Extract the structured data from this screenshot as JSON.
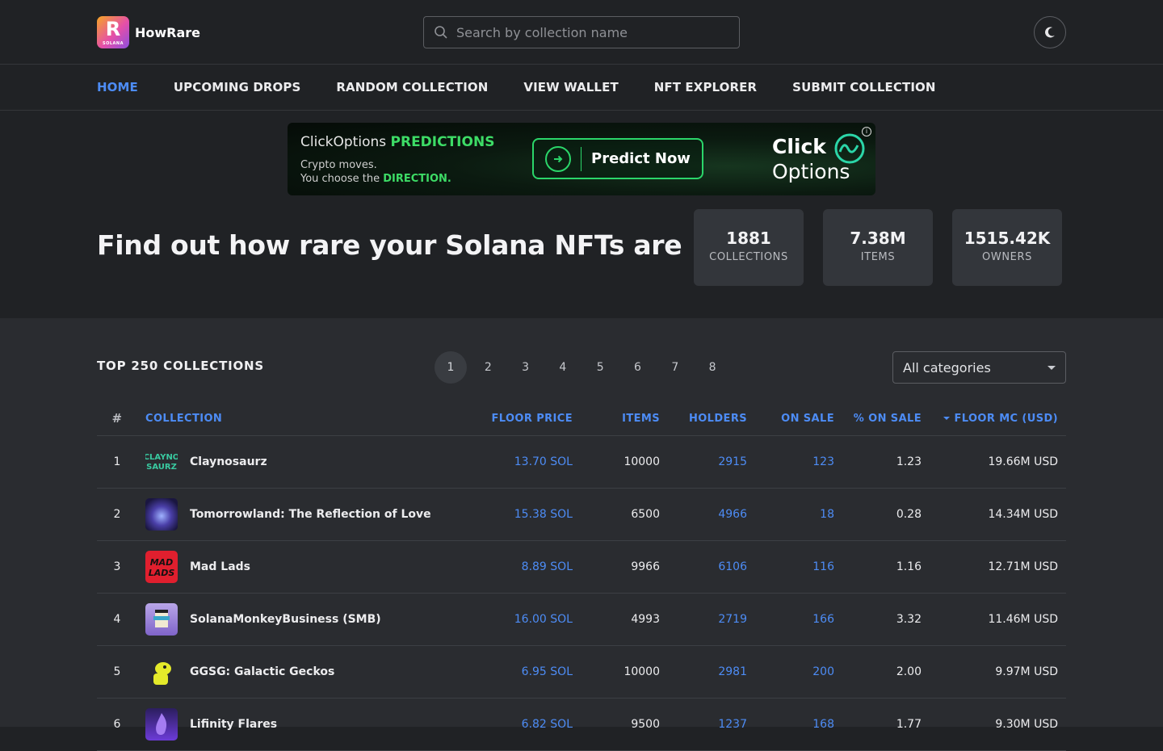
{
  "brand": {
    "name": "HowRare",
    "badge_letter": "R",
    "badge_sub": "SOLANA"
  },
  "search": {
    "placeholder": "Search by collection name"
  },
  "nav": {
    "items": [
      "HOME",
      "UPCOMING DROPS",
      "RANDOM COLLECTION",
      "VIEW WALLET",
      "NFT EXPLORER",
      "SUBMIT COLLECTION"
    ],
    "active": "HOME"
  },
  "ad": {
    "headline_prefix": "ClickOptions ",
    "headline_accent": "PREDICTIONS",
    "line1": "Crypto moves.",
    "line2_prefix": "You choose the ",
    "line2_accent": "DIRECTION.",
    "cta": "Predict Now",
    "brand_line1": "Click",
    "brand_line2": "Options",
    "accent_color": "#3ddc66"
  },
  "hero": {
    "title": "Find out how rare your Solana NFTs are"
  },
  "stats": [
    {
      "value": "1881",
      "label": "COLLECTIONS"
    },
    {
      "value": "7.38M",
      "label": "ITEMS"
    },
    {
      "value": "1515.42K",
      "label": "OWNERS"
    }
  ],
  "collections": {
    "title": "TOP 250 COLLECTIONS",
    "pages": [
      "1",
      "2",
      "3",
      "4",
      "5",
      "6",
      "7",
      "8"
    ],
    "current_page": "1",
    "category_select": "All categories",
    "columns": {
      "rank": "#",
      "collection": "COLLECTION",
      "floor_price": "FLOOR PRICE",
      "items": "ITEMS",
      "holders": "HOLDERS",
      "on_sale": "ON SALE",
      "pct_on_sale": "% ON SALE",
      "floor_mc": "FLOOR MC (USD)"
    },
    "rows": [
      {
        "rank": "1",
        "name": "Claynosaurz",
        "floor": "13.70 SOL",
        "items": "10000",
        "holders": "2915",
        "on_sale": "123",
        "pct": "1.23",
        "mc": "19.66M USD",
        "thumb_text": "CLAYNO SAURZ"
      },
      {
        "rank": "2",
        "name": "Tomorrowland: The Reflection of Love",
        "floor": "15.38 SOL",
        "items": "6500",
        "holders": "4966",
        "on_sale": "18",
        "pct": "0.28",
        "mc": "14.34M USD",
        "thumb_text": ""
      },
      {
        "rank": "3",
        "name": "Mad Lads",
        "floor": "8.89 SOL",
        "items": "9966",
        "holders": "6106",
        "on_sale": "116",
        "pct": "1.16",
        "mc": "12.71M USD",
        "thumb_text": "MAD LADS"
      },
      {
        "rank": "4",
        "name": "SolanaMonkeyBusiness (SMB)",
        "floor": "16.00 SOL",
        "items": "4993",
        "holders": "2719",
        "on_sale": "166",
        "pct": "3.32",
        "mc": "11.46M USD",
        "thumb_text": ""
      },
      {
        "rank": "5",
        "name": "GGSG: Galactic Geckos",
        "floor": "6.95 SOL",
        "items": "10000",
        "holders": "2981",
        "on_sale": "200",
        "pct": "2.00",
        "mc": "9.97M USD",
        "thumb_text": ""
      },
      {
        "rank": "6",
        "name": "Lifinity Flares",
        "floor": "6.82 SOL",
        "items": "9500",
        "holders": "1237",
        "on_sale": "168",
        "pct": "1.77",
        "mc": "9.30M USD",
        "thumb_text": ""
      }
    ]
  },
  "colors": {
    "accent": "#4d8cf5",
    "bg": "#202225",
    "panel": "#2a2c30"
  }
}
